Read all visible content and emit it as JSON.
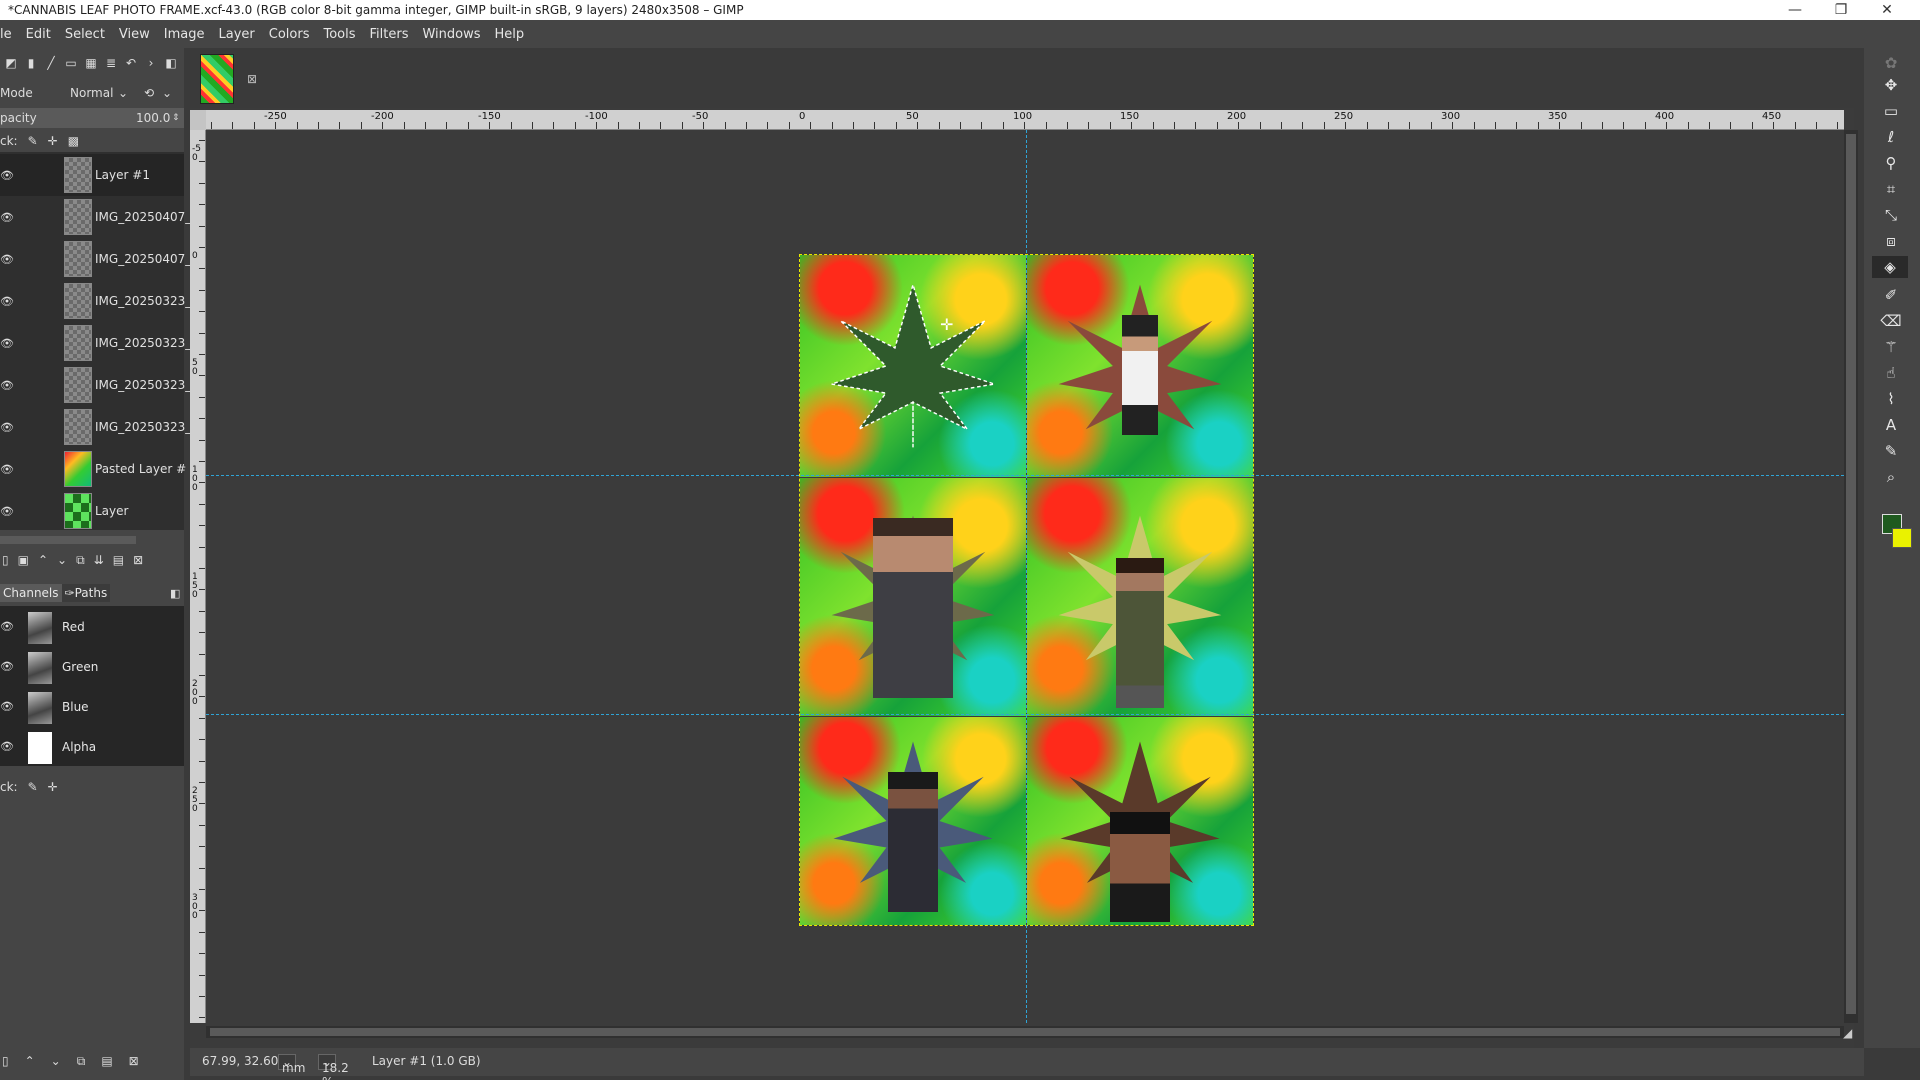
{
  "window": {
    "title": "*CANNABIS LEAF PHOTO FRAME.xcf-43.0 (RGB color 8-bit gamma integer, GIMP built-in sRGB, 9 layers) 2480x3508 – GIMP",
    "minimize": "—",
    "maximize": "❐",
    "close": "✕"
  },
  "menu": [
    "le",
    "Edit",
    "Select",
    "View",
    "Image",
    "Layer",
    "Colors",
    "Tools",
    "Filters",
    "Windows",
    "Help"
  ],
  "dock": {
    "mode_label": "Mode",
    "mode_value": "Normal",
    "opacity_label": "pacity",
    "opacity_value": "100.0",
    "lock_label": "ck:",
    "layers": [
      {
        "name": "Layer #1",
        "thumb": "checker"
      },
      {
        "name": "IMG_20250407_",
        "thumb": "checker"
      },
      {
        "name": "IMG_20250407_",
        "thumb": "checker"
      },
      {
        "name": "IMG_20250323_",
        "thumb": "checker"
      },
      {
        "name": "IMG_20250323_",
        "thumb": "checker"
      },
      {
        "name": "IMG_20250323_",
        "thumb": "checker"
      },
      {
        "name": "IMG_20250323_",
        "thumb": "checker"
      },
      {
        "name": "Pasted Layer #",
        "thumb": "pasted"
      },
      {
        "name": "Layer",
        "thumb": "green"
      }
    ],
    "tabs": {
      "channels": "Channels",
      "paths": "Paths"
    },
    "channels": [
      "Red",
      "Green",
      "Blue",
      "Alpha"
    ],
    "channel_lock_label": "ck:"
  },
  "ruler": {
    "h_labels": [
      "-250",
      "-200",
      "-150",
      "-100",
      "-50",
      "0",
      "50",
      "100",
      "150",
      "200",
      "250",
      "300",
      "350",
      "400",
      "450"
    ],
    "v_labels": [
      "-50",
      "0",
      "50",
      "100",
      "150",
      "200",
      "250",
      "300"
    ]
  },
  "status": {
    "coords": "67.99, 32.60",
    "unit": "mm",
    "zoom": "18.2 %",
    "layer_info": "Layer #1 (1.0 GB)"
  },
  "colors": {
    "foreground": "#1f5a1f",
    "background": "#eaf200",
    "guide": "#2fa4d6"
  }
}
